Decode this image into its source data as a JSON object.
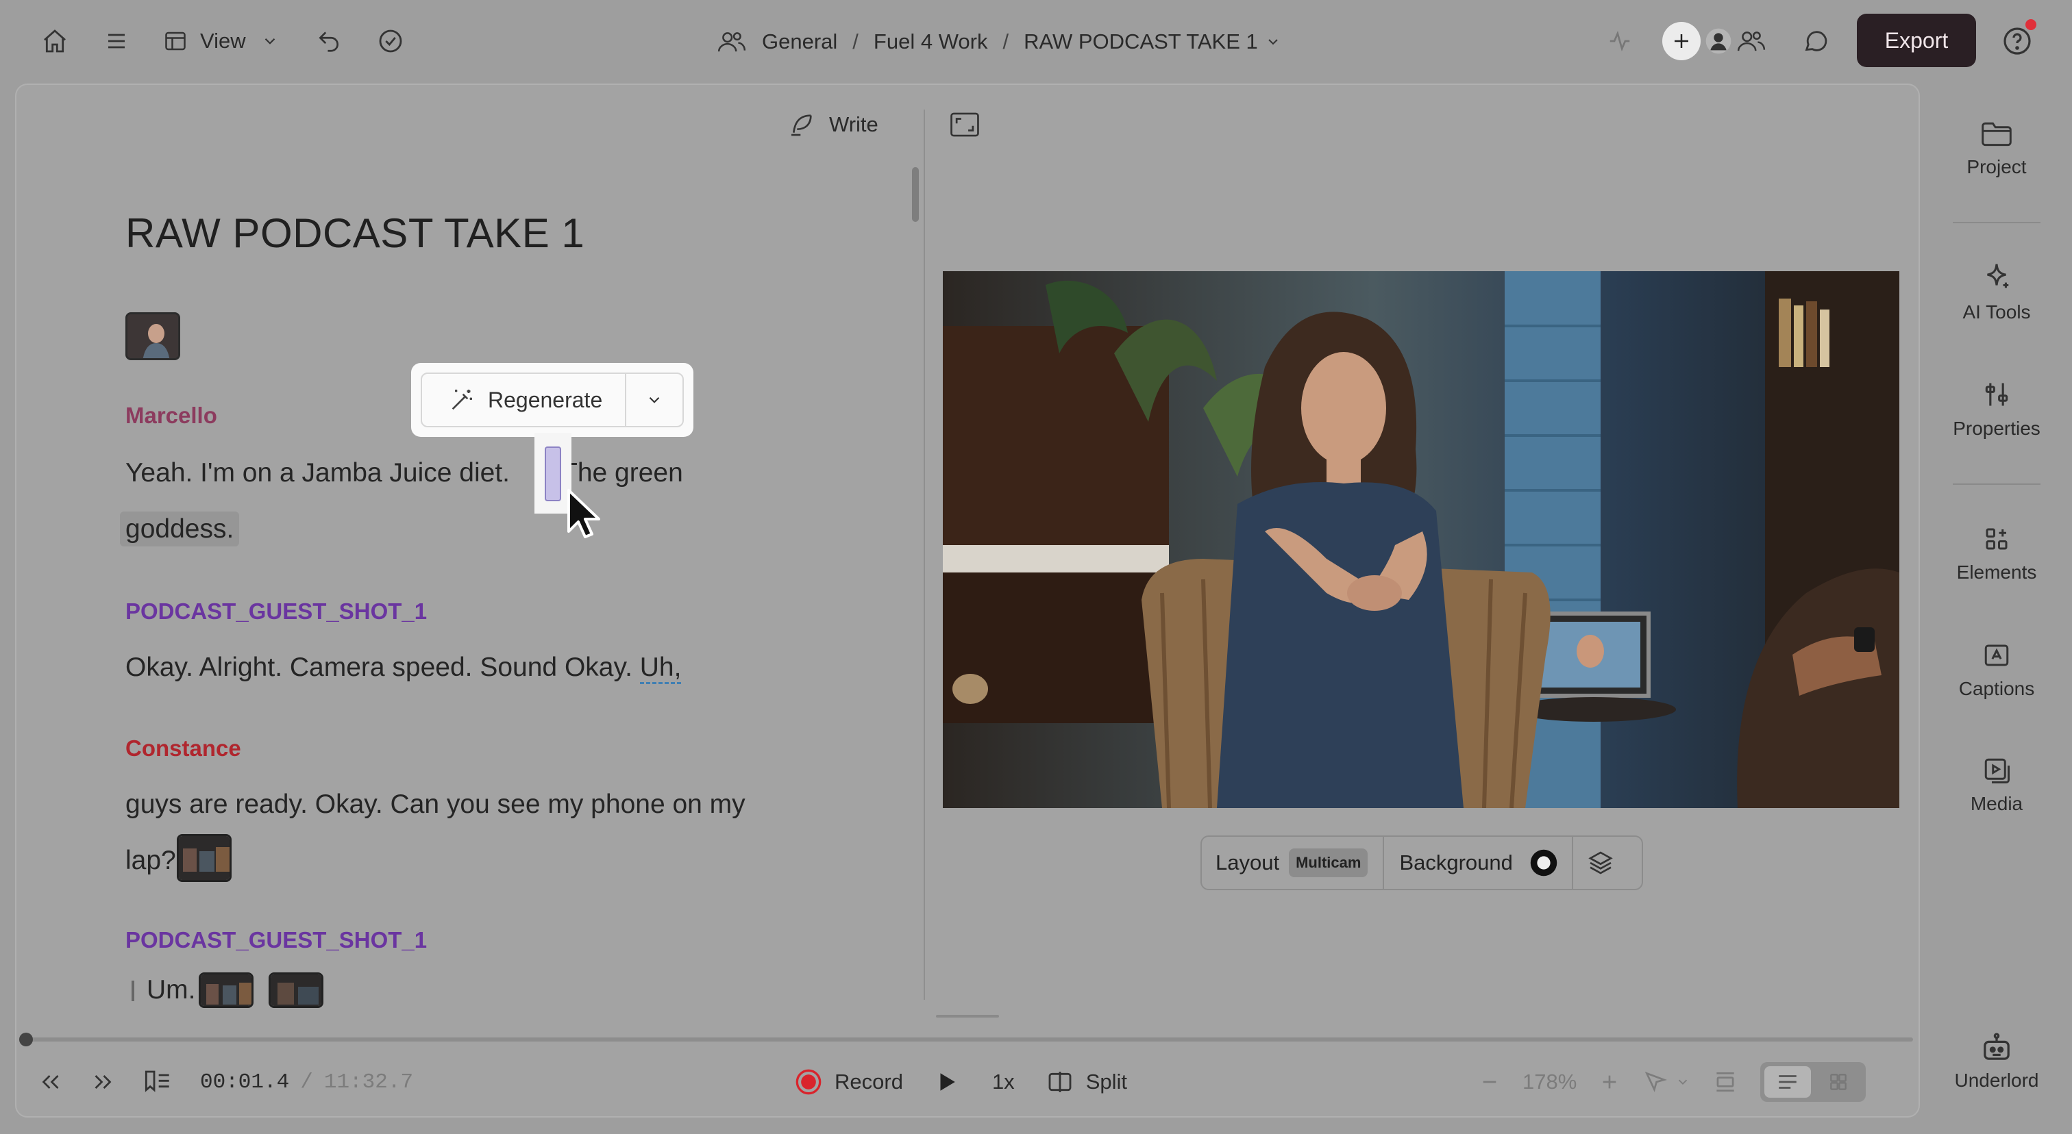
{
  "topbar": {
    "view_label": "View",
    "breadcrumb": [
      "General",
      "Fuel 4 Work",
      "RAW PODCAST TAKE 1"
    ],
    "breadcrumb_sep": "/",
    "export_label": "Export",
    "help_label": "?"
  },
  "editor": {
    "write_label": "Write",
    "doc_title": "RAW PODCAST TAKE 1",
    "toolbar": {
      "regenerate_label": "Regenerate"
    },
    "blocks": [
      {
        "speaker": "Marcello",
        "speaker_color": "#8c3b5e",
        "text_a": "Yeah. I'm on a Jamba Juice diet.",
        "text_b": "The green",
        "text_c": "goddess."
      },
      {
        "speaker": "PODCAST_GUEST_SHOT_1",
        "speaker_color": "#6a35a0",
        "text_a": "Okay. Alright. Camera speed. Sound Okay.",
        "text_uh": "Uh,"
      },
      {
        "speaker": "Constance",
        "speaker_color": "#b0262e",
        "text_a": "guys are ready. Okay. Can you see my phone on my",
        "text_b": "lap?"
      },
      {
        "speaker": "PODCAST_GUEST_SHOT_1",
        "speaker_color": "#6a35a0",
        "text_a": "Um."
      }
    ]
  },
  "preview": {
    "layout_label": "Layout",
    "layout_value": "Multicam",
    "background_label": "Background"
  },
  "rail": {
    "project": "Project",
    "ai_tools": "AI Tools",
    "properties": "Properties",
    "elements": "Elements",
    "captions": "Captions",
    "media": "Media",
    "underlord": "Underlord"
  },
  "transport": {
    "current_time": "00:01.4",
    "time_sep": "/",
    "total_time": "11:32.7",
    "record_label": "Record",
    "speed": "1x",
    "split_label": "Split",
    "zoom": "178%"
  },
  "colors": {
    "export_bg": "#2a1f24",
    "record_red": "#d9242c",
    "notification": "#e0303a"
  }
}
